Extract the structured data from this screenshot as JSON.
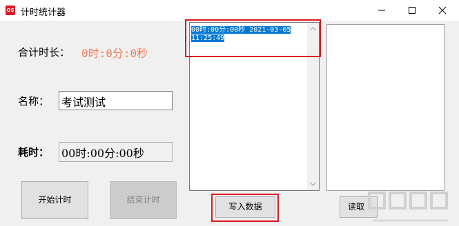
{
  "window": {
    "title": "计时统计器",
    "icon_text": "OS",
    "accent": "#e81123"
  },
  "labels": {
    "total": "合计时长：",
    "name": "名称：",
    "elapsed": "耗时："
  },
  "total_value": "0时:0分:0秒",
  "name_input_value": "考试测试",
  "elapsed_value": "00时:00分:00秒",
  "buttons": {
    "start": "开始计时",
    "end": "结束计时",
    "write": "写入数据",
    "read": "读取"
  },
  "records": [
    "00时:00分:00秒 2021-03-05 11:25:49"
  ]
}
